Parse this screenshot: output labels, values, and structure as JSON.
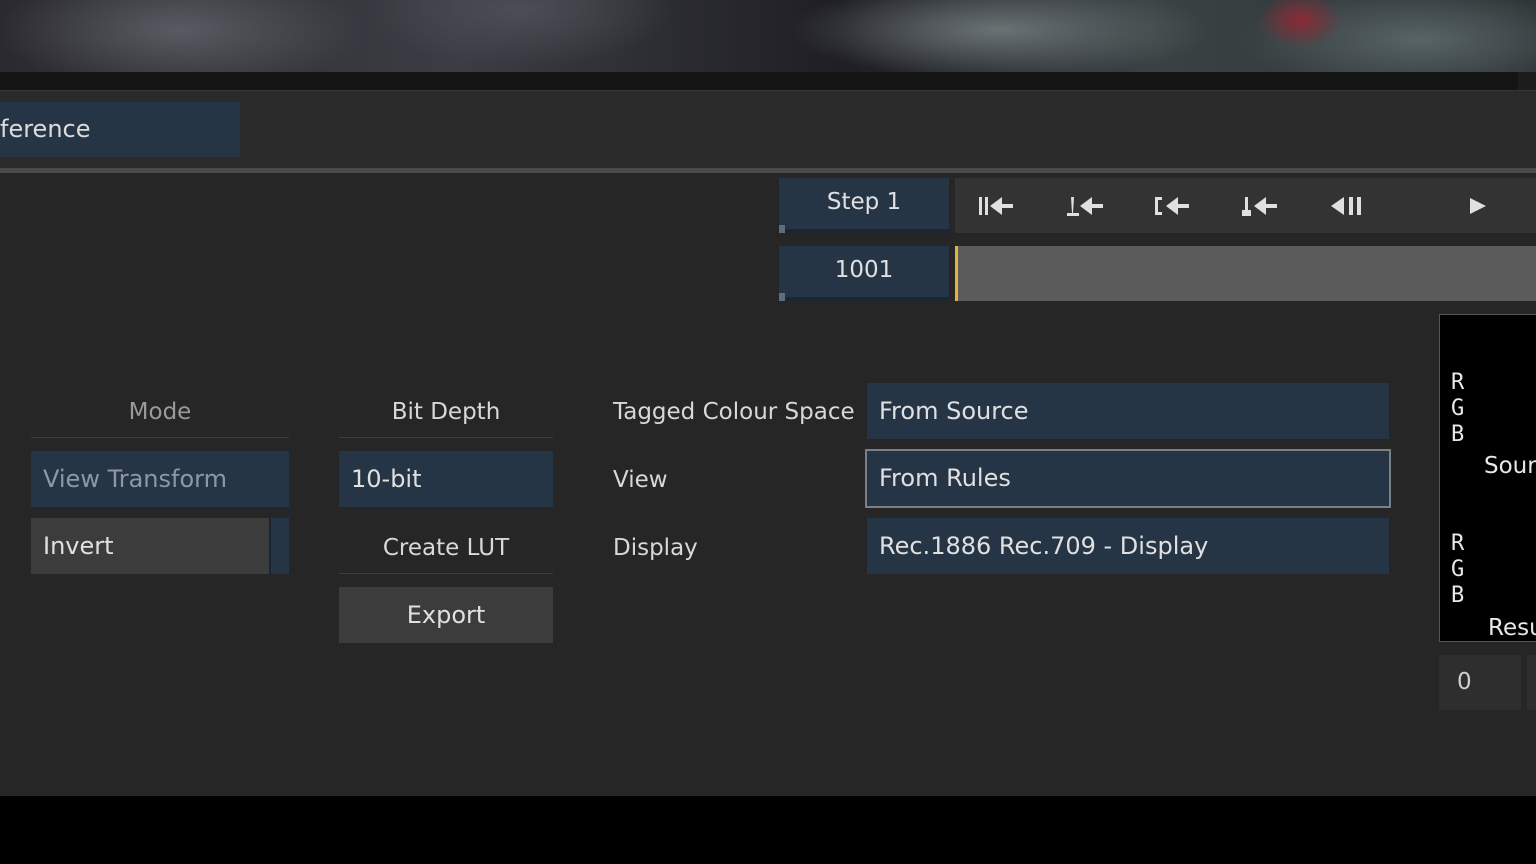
{
  "tab": {
    "label": "ference"
  },
  "transport": {
    "step_label": "Step 1",
    "frame_value": "1001",
    "buttons": {
      "go_start": "go-to-start",
      "prev_key": "previous-keyframe",
      "prev_in": "previous-in-point",
      "prev_mark": "previous-marker",
      "step_back": "step-back",
      "play": "play"
    }
  },
  "mode": {
    "header": "Mode",
    "selected": "View Transform",
    "invert_label": "Invert"
  },
  "bit_depth": {
    "header": "Bit Depth",
    "value": "10-bit",
    "create_lut_header": "Create LUT",
    "export_label": "Export"
  },
  "colour": {
    "tagged_label": "Tagged Colour Space",
    "tagged_value": "From Source",
    "view_label": "View",
    "view_value": "From Rules",
    "display_label": "Display",
    "display_value": "Rec.1886 Rec.709 - Display"
  },
  "scope": {
    "source_channels": [
      "R",
      "G",
      "B"
    ],
    "source_label": "Sour",
    "result_channels": [
      "R",
      "G",
      "B"
    ],
    "result_label": "Resu",
    "value": "0"
  },
  "colors": {
    "accent_blue": "#263546",
    "playhead": "#e2b437"
  }
}
